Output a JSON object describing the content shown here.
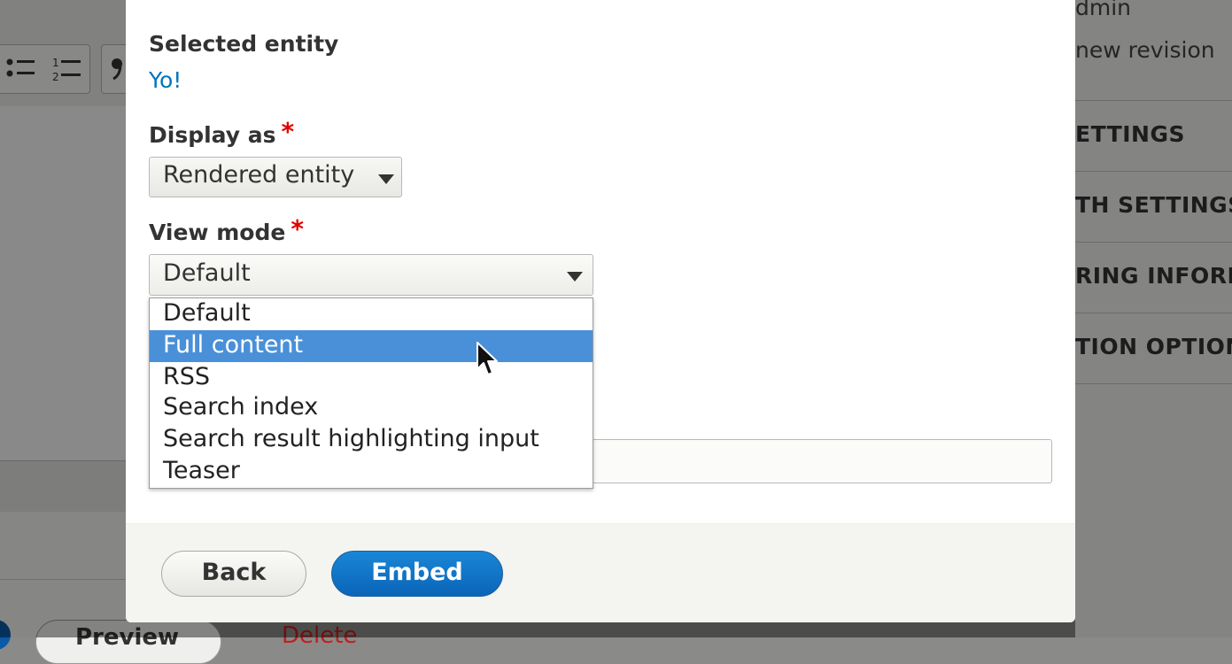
{
  "dialog": {
    "selected_entity_label": "Selected entity",
    "selected_entity_link": "Yo!",
    "display_as": {
      "label": "Display as",
      "required_marker": "*",
      "value": "Rendered entity"
    },
    "view_mode": {
      "label": "View mode",
      "required_marker": "*",
      "value": "Default",
      "options": [
        "Default",
        "Full content",
        "RSS",
        "Search index",
        "Search result highlighting input",
        "Teaser"
      ],
      "highlighted_option": "Full content"
    },
    "footer": {
      "back_label": "Back",
      "embed_label": "Embed"
    }
  },
  "background": {
    "sidebar": {
      "author_fragment": "dmin",
      "revision_fragment": "new revision",
      "sections": [
        "ETTINGS",
        "TH SETTINGS",
        "RING INFORM",
        "TION OPTION"
      ]
    },
    "preview_fragment": "Preview",
    "delete_fragment": "Delete"
  },
  "colors": {
    "link": "#0074bd",
    "required": "#e00000",
    "highlight": "#4a90d9",
    "primary_button": "#0a65b8"
  }
}
